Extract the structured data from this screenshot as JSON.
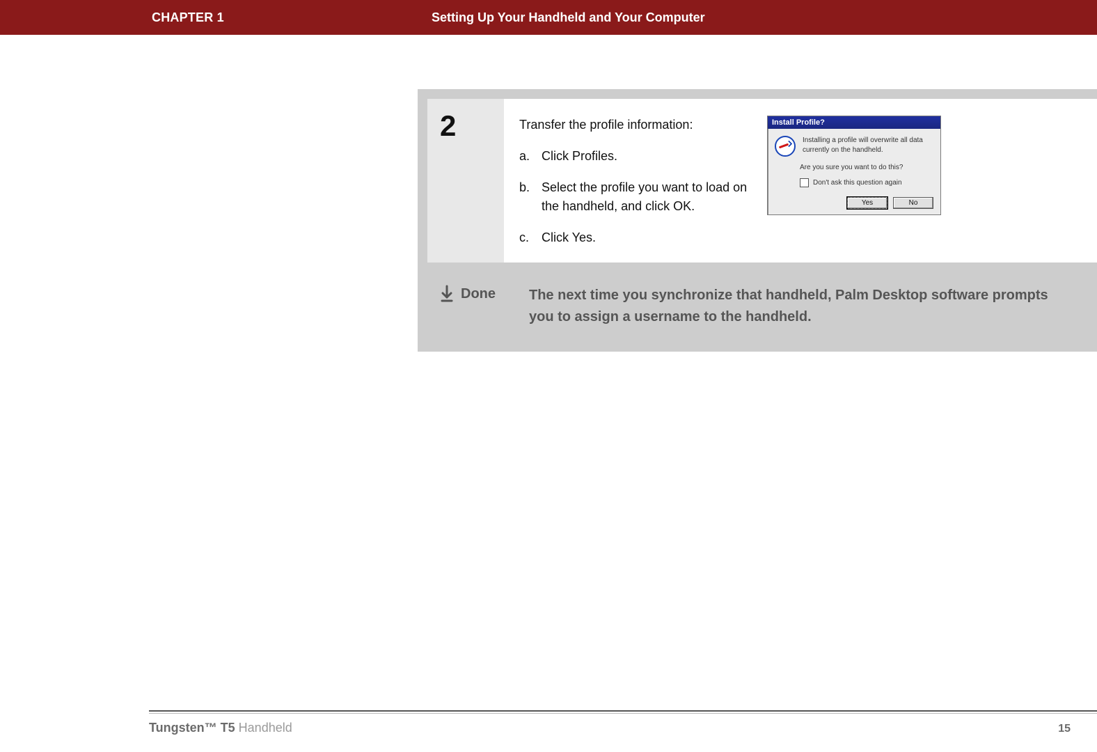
{
  "header": {
    "chapter": "CHAPTER 1",
    "title": "Setting Up Your Handheld and Your Computer"
  },
  "step": {
    "number": "2",
    "intro": "Transfer the profile information:",
    "subs": [
      {
        "letter": "a.",
        "text": "Click Profiles."
      },
      {
        "letter": "b.",
        "text": "Select the profile you want to load on the handheld, and click OK."
      },
      {
        "letter": "c.",
        "text": "Click Yes."
      }
    ]
  },
  "dialog": {
    "title": "Install Profile?",
    "line1": "Installing a profile will overwrite all data currently on the handheld.",
    "question": "Are you sure you want to do this?",
    "checkbox_label": "Don't ask this question again",
    "yes": "Yes",
    "no": "No"
  },
  "done": {
    "label": "Done",
    "text": "The next time you synchronize that handheld, Palm Desktop software prompts you to assign a username to the handheld."
  },
  "footer": {
    "product_bold": "Tungsten™ T5",
    "product_rest": " Handheld",
    "page": "15"
  }
}
